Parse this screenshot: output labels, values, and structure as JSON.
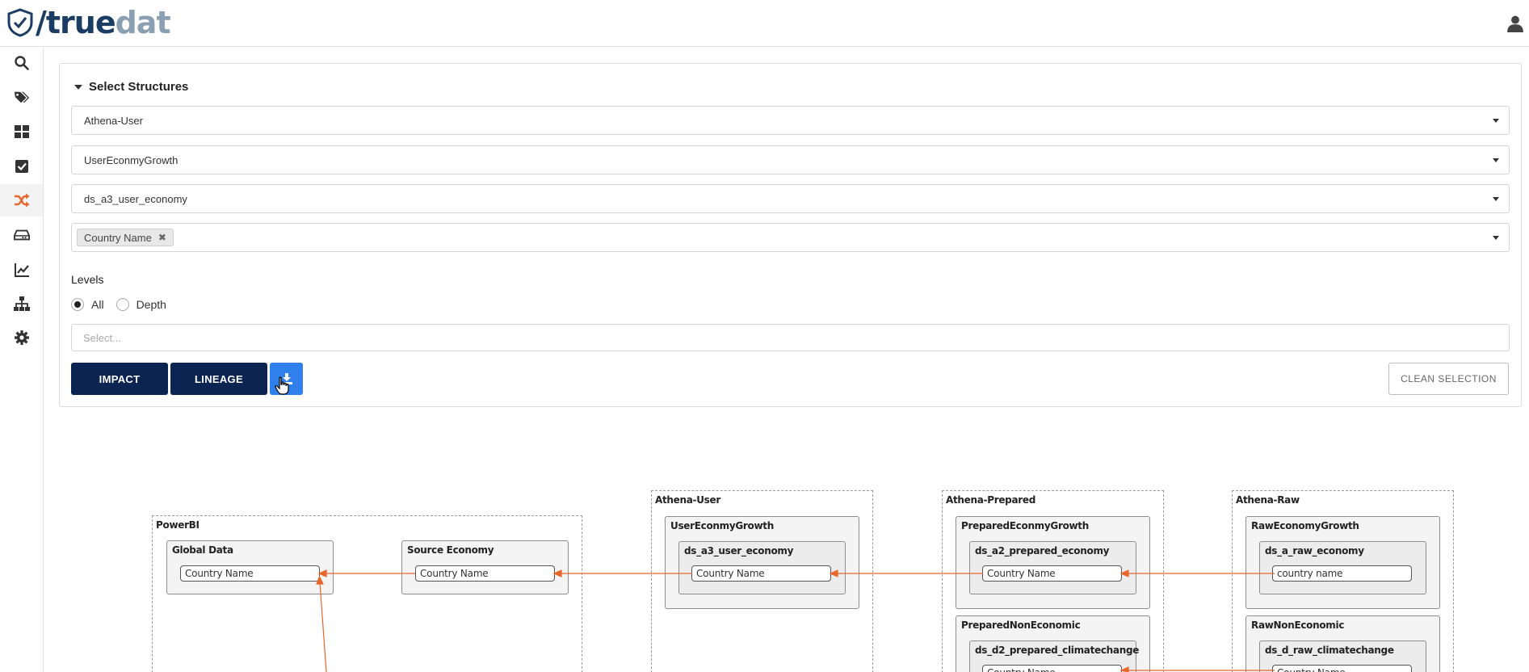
{
  "app": {
    "logo_part1": "/true",
    "logo_part2": "dat"
  },
  "sidebar": {
    "items": [
      {
        "name": "search"
      },
      {
        "name": "tags"
      },
      {
        "name": "dashboard"
      },
      {
        "name": "check"
      },
      {
        "name": "lineage",
        "active": true
      },
      {
        "name": "storage"
      },
      {
        "name": "chart"
      },
      {
        "name": "hierarchy"
      },
      {
        "name": "settings"
      }
    ]
  },
  "panel": {
    "title": "Select Structures",
    "system_value": "Athena-User",
    "group_value": "UserEconmyGrowth",
    "structure_value": "ds_a3_user_economy",
    "field_tag": "Country Name",
    "levels_label": "Levels",
    "radio_all": "All",
    "radio_depth": "Depth",
    "depth_placeholder": "Select...",
    "impact_label": "IMPACT",
    "lineage_label": "LINEAGE",
    "clean_label": "CLEAN SELECTION"
  },
  "graph": {
    "powerbi": {
      "title": "PowerBI",
      "global_data": {
        "title": "Global Data",
        "field": "Country Name"
      },
      "source_economy": {
        "title": "Source Economy",
        "field": "Country Name"
      }
    },
    "athena_user": {
      "title": "Athena-User",
      "group": "UserEconmyGrowth",
      "structure": "ds_a3_user_economy",
      "field": "Country Name"
    },
    "athena_prepared": {
      "title": "Athena-Prepared",
      "group1": "PreparedEconmyGrowth",
      "structure1": "ds_a2_prepared_economy",
      "field1": "Country Name",
      "group2": "PreparedNonEconomic",
      "structure2": "ds_d2_prepared_climatechange",
      "field2": "Country Name"
    },
    "athena_raw": {
      "title": "Athena-Raw",
      "group1": "RawEconomyGrowth",
      "structure1": "ds_a_raw_economy",
      "field1": "country name",
      "group2": "RawNonEconomic",
      "structure2": "ds_d_raw_climatechange",
      "field2": "Country Name"
    },
    "edge_color": "#e8662a"
  }
}
